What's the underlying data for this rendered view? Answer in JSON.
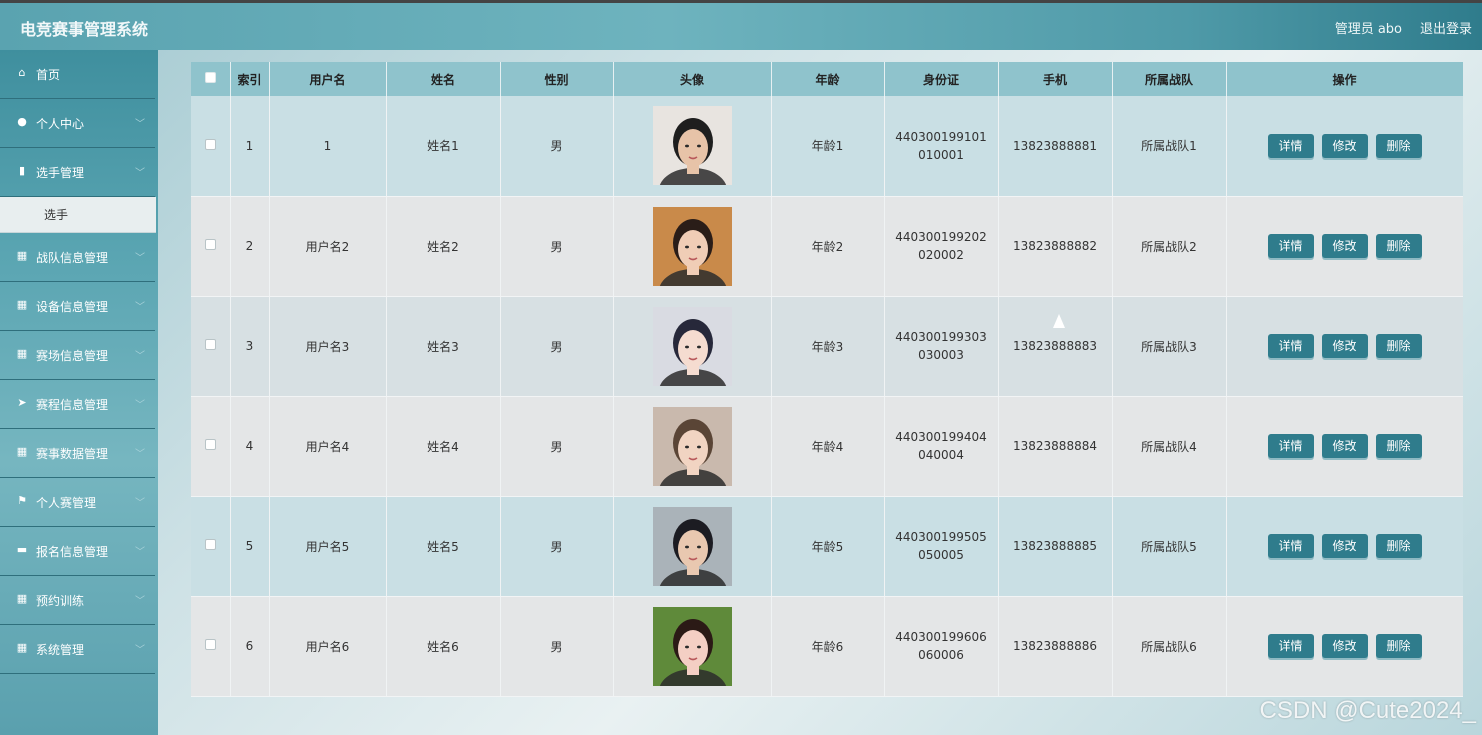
{
  "header": {
    "title": "电竞赛事管理系统",
    "user": "管理员 abo",
    "logout": "退出登录"
  },
  "sidebar": {
    "items": [
      {
        "label": "首页",
        "icon": "home-icon",
        "glyph": "⌂"
      },
      {
        "label": "个人中心",
        "icon": "user-icon",
        "glyph": "●",
        "chevron": "﹀"
      },
      {
        "label": "选手管理",
        "icon": "clipboard-icon",
        "glyph": "▮",
        "chevron": "﹀"
      },
      {
        "label": "战队信息管理",
        "icon": "grid-icon",
        "glyph": "▦",
        "chevron": "﹀"
      },
      {
        "label": "设备信息管理",
        "icon": "grid-icon",
        "glyph": "▦",
        "chevron": "﹀"
      },
      {
        "label": "赛场信息管理",
        "icon": "table-icon",
        "glyph": "▦",
        "chevron": "﹀"
      },
      {
        "label": "赛程信息管理",
        "icon": "send-icon",
        "glyph": "➤",
        "chevron": "﹀"
      },
      {
        "label": "赛事数据管理",
        "icon": "grid-icon",
        "glyph": "▦",
        "chevron": "﹀"
      },
      {
        "label": "个人赛管理",
        "icon": "flag-icon",
        "glyph": "⚑",
        "chevron": "﹀"
      },
      {
        "label": "报名信息管理",
        "icon": "briefcase-icon",
        "glyph": "▬",
        "chevron": "﹀"
      },
      {
        "label": "预约训练",
        "icon": "grid-icon",
        "glyph": "▦",
        "chevron": "﹀"
      },
      {
        "label": "系统管理",
        "icon": "grid-icon",
        "glyph": "▦",
        "chevron": "﹀"
      }
    ],
    "submenu": {
      "label": "选手"
    }
  },
  "table": {
    "columns": [
      "索引",
      "用户名",
      "姓名",
      "性别",
      "头像",
      "年龄",
      "身份证",
      "手机",
      "所属战队",
      "操作"
    ],
    "rows": [
      {
        "index": "1",
        "username": "1",
        "name": "姓名1",
        "gender": "男",
        "age": "年龄1",
        "idcard": "440300199101010001",
        "phone": "13823888881",
        "team": "所属战队1"
      },
      {
        "index": "2",
        "username": "用户名2",
        "name": "姓名2",
        "gender": "男",
        "age": "年龄2",
        "idcard": "440300199202020002",
        "phone": "13823888882",
        "team": "所属战队2"
      },
      {
        "index": "3",
        "username": "用户名3",
        "name": "姓名3",
        "gender": "男",
        "age": "年龄3",
        "idcard": "440300199303030003",
        "phone": "13823888883",
        "team": "所属战队3"
      },
      {
        "index": "4",
        "username": "用户名4",
        "name": "姓名4",
        "gender": "男",
        "age": "年龄4",
        "idcard": "440300199404040004",
        "phone": "13823888884",
        "team": "所属战队4"
      },
      {
        "index": "5",
        "username": "用户名5",
        "name": "姓名5",
        "gender": "男",
        "age": "年龄5",
        "idcard": "440300199505050005",
        "phone": "13823888885",
        "team": "所属战队5"
      },
      {
        "index": "6",
        "username": "用户名6",
        "name": "姓名6",
        "gender": "男",
        "age": "年龄6",
        "idcard": "440300199606060006",
        "phone": "13823888886",
        "team": "所属战队6"
      }
    ],
    "actions": {
      "detail": "详情",
      "edit": "修改",
      "delete": "删除"
    },
    "avatar_palette": [
      {
        "bg": "#e8e4e0",
        "skin": "#e7c3a8",
        "hair": "#1e1e1e"
      },
      {
        "bg": "#c98a4a",
        "skin": "#f0cdb6",
        "hair": "#2a1d18"
      },
      {
        "bg": "#d9dbe2",
        "skin": "#f5dcd0",
        "hair": "#27283a"
      },
      {
        "bg": "#c9b9ad",
        "skin": "#f1d4c2",
        "hair": "#5a4536"
      },
      {
        "bg": "#aab3b9",
        "skin": "#e9c8b0",
        "hair": "#1c1c22"
      },
      {
        "bg": "#5f8a3a",
        "skin": "#f4cfc4",
        "hair": "#2b1a16"
      }
    ]
  },
  "watermark": "CSDN @Cute2024_"
}
